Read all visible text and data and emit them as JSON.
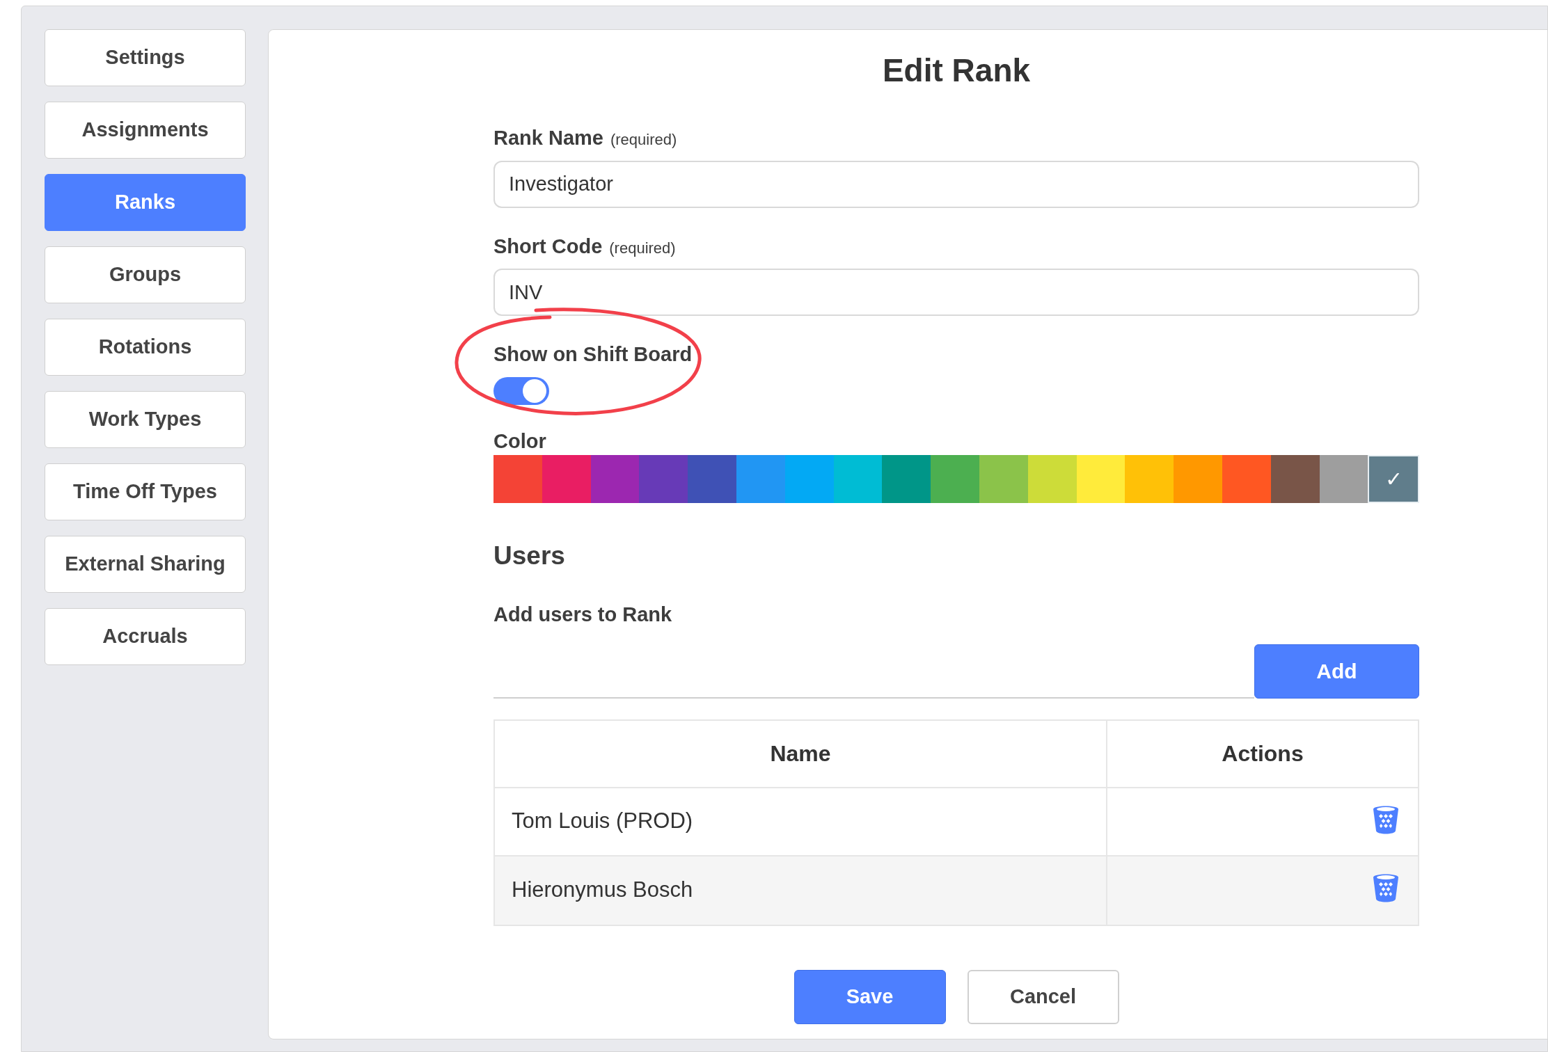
{
  "sidebar": {
    "items": [
      {
        "label": "Settings",
        "selected": false
      },
      {
        "label": "Assignments",
        "selected": false
      },
      {
        "label": "Ranks",
        "selected": true
      },
      {
        "label": "Groups",
        "selected": false
      },
      {
        "label": "Rotations",
        "selected": false
      },
      {
        "label": "Work Types",
        "selected": false
      },
      {
        "label": "Time Off Types",
        "selected": false
      },
      {
        "label": "External Sharing",
        "selected": false
      },
      {
        "label": "Accruals",
        "selected": false
      }
    ]
  },
  "form": {
    "title": "Edit Rank",
    "fields": [
      {
        "label": "Rank Name",
        "hint": "(required)",
        "value": "Investigator"
      },
      {
        "label": "Short Code",
        "hint": "(required)",
        "value": "INV"
      }
    ],
    "toggle": {
      "label": "Show on Shift Board",
      "on": true
    },
    "color": {
      "label": "Color",
      "swatches": [
        {
          "color": "#f44336",
          "selected": false
        },
        {
          "color": "#e91e63",
          "selected": false
        },
        {
          "color": "#9c27b0",
          "selected": false
        },
        {
          "color": "#673ab7",
          "selected": false
        },
        {
          "color": "#3f51b5",
          "selected": false
        },
        {
          "color": "#2196f3",
          "selected": false
        },
        {
          "color": "#03a9f4",
          "selected": false
        },
        {
          "color": "#00bcd4",
          "selected": false
        },
        {
          "color": "#009688",
          "selected": false
        },
        {
          "color": "#4caf50",
          "selected": false
        },
        {
          "color": "#8bc34a",
          "selected": false
        },
        {
          "color": "#cddc39",
          "selected": false
        },
        {
          "color": "#ffeb3b",
          "selected": false
        },
        {
          "color": "#ffc107",
          "selected": false
        },
        {
          "color": "#ff9800",
          "selected": false
        },
        {
          "color": "#ff5722",
          "selected": false
        },
        {
          "color": "#795548",
          "selected": false
        },
        {
          "color": "#9e9e9e",
          "selected": false
        },
        {
          "color": "#607d8b",
          "selected": true
        }
      ],
      "check": "✓"
    }
  },
  "users": {
    "heading": "Users",
    "add_label": "Add users to Rank",
    "add_button": "Add",
    "table": {
      "columns": [
        "Name",
        "Actions"
      ],
      "rows": [
        {
          "name": "Tom Louis (PROD)"
        },
        {
          "name": "Hieronymus Bosch"
        }
      ]
    }
  },
  "buttons": [
    {
      "label": "Save",
      "kind": "primary"
    },
    {
      "label": "Cancel",
      "kind": "secondary"
    }
  ]
}
